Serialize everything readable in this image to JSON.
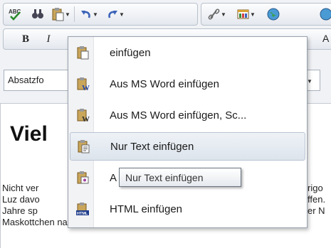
{
  "toolbar": {
    "row2_right_glyph": "A",
    "format_combo_value": "Absatzfo"
  },
  "editor": {
    "heading": "Viel",
    "lines": [
      "Nicht ver",
      "Luz davo",
      "Jahre sp",
      "Maskottchen nahe bei der Auswahl aufhält. Sie sch"
    ],
    "right_fragments": [
      "rigo",
      "ffen.",
      "er N"
    ]
  },
  "menu": {
    "items": [
      {
        "label": "einfügen",
        "icon": "paste-icon"
      },
      {
        "label": "Aus MS Word einfügen",
        "icon": "paste-word-icon"
      },
      {
        "label": "Aus MS Word einfügen, Sc...",
        "icon": "paste-word-clean-icon"
      },
      {
        "label": "Nur Text einfügen",
        "icon": "paste-text-icon"
      },
      {
        "label": "A",
        "icon": "paste-special-icon"
      },
      {
        "label": "HTML einfügen",
        "icon": "paste-html-icon"
      }
    ],
    "highlighted_index": 3
  },
  "tooltip": {
    "text": "Nur Text einfügen"
  },
  "colors": {
    "accent": "#dde4ec",
    "link_red": "#c0392b"
  }
}
